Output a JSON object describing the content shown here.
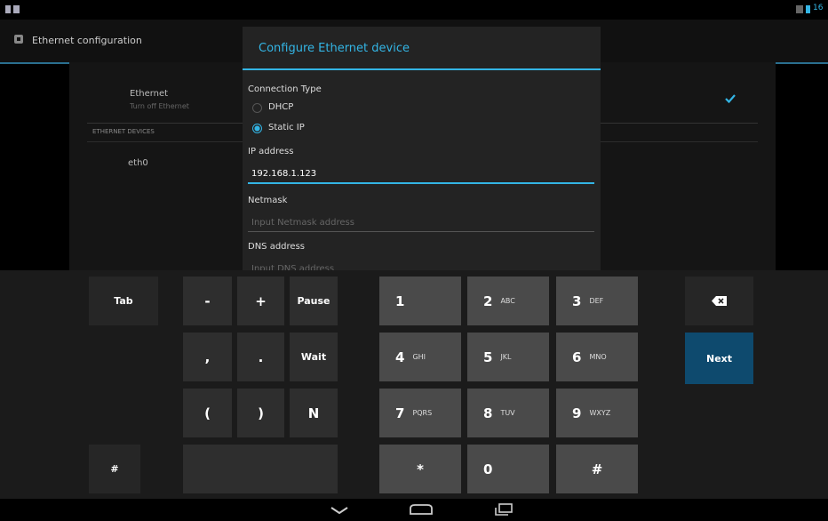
{
  "status_bar": {
    "time": "16"
  },
  "action_bar": {
    "title": "Ethernet configuration"
  },
  "settings": {
    "ethernet_title": "Ethernet",
    "ethernet_sub": "Turn off Ethernet",
    "section_header": "ETHERNET DEVICES",
    "device": "eth0"
  },
  "dialog": {
    "title": "Configure Ethernet device",
    "connection_type_label": "Connection Type",
    "options": [
      "DHCP",
      "Static IP"
    ],
    "selected_option": "Static IP",
    "ip_label": "IP address",
    "ip_value": "192.168.1.123",
    "netmask_label": "Netmask",
    "netmask_placeholder": "Input Netmask address",
    "dns_label": "DNS address",
    "dns_placeholder": "Input DNS address"
  },
  "keyboard": {
    "tab": "Tab",
    "minus": "-",
    "plus": "+",
    "pause": "Pause",
    "comma": ",",
    "period": ".",
    "wait": "Wait",
    "lparen": "(",
    "rparen": ")",
    "n": "N",
    "digits": [
      {
        "d": "1",
        "l": ""
      },
      {
        "d": "2",
        "l": "ABC"
      },
      {
        "d": "3",
        "l": "DEF"
      },
      {
        "d": "4",
        "l": "GHI"
      },
      {
        "d": "5",
        "l": "JKL"
      },
      {
        "d": "6",
        "l": "MNO"
      },
      {
        "d": "7",
        "l": "PQRS"
      },
      {
        "d": "8",
        "l": "TUV"
      },
      {
        "d": "9",
        "l": "WXYZ"
      }
    ],
    "star": "*",
    "zero": "0",
    "hash": "#",
    "next": "Next",
    "symbols": "#"
  },
  "colors": {
    "accent": "#33b5e5",
    "next_key": "#0e4a6e"
  }
}
